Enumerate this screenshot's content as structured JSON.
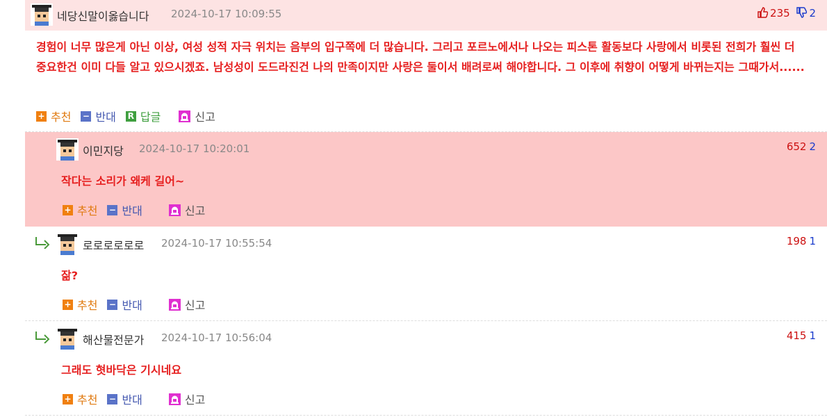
{
  "comments": [
    {
      "nick": "네당신말이옳습니다",
      "date": "2024-10-17 10:09:55",
      "up": "235",
      "down": "2",
      "text": "경험이 너무 많은게 아닌 이상, 여성 성적 자극 위치는 음부의 입구쪽에 더 많습니다. 그리고 포르노에서나 나오는 피스톤 활동보다 사랑에서 비롯된 전희가 훨씬 더 중요한건 이미 다들 알고 있으시겠죠. 남성성이 도드라진건 나의 만족이지만 사랑은 둘이서 배려로써 해야합니다. 그 이후에 취향이 어떻게 바뀌는지는 그때가서......",
      "actions": {
        "up": "추천",
        "down": "반대",
        "reply": "답글",
        "report": "신고"
      }
    },
    {
      "nick": "이민지당",
      "date": "2024-10-17 10:20:01",
      "up": "652",
      "down": "2",
      "text": "작다는 소리가 왜케 길어~",
      "actions": {
        "up": "추천",
        "down": "반대",
        "report": "신고"
      }
    },
    {
      "nick": "로로로로로로",
      "date": "2024-10-17 10:55:54",
      "up": "198",
      "down": "1",
      "text": "잚?",
      "actions": {
        "up": "추천",
        "down": "반대",
        "report": "신고"
      }
    },
    {
      "nick": "해산물전문가",
      "date": "2024-10-17 10:56:04",
      "up": "415",
      "down": "1",
      "text": "그래도 혓바닥은 기시네요",
      "actions": {
        "up": "추천",
        "down": "반대",
        "report": "신고"
      }
    }
  ],
  "icons": {
    "avatar": "graduate-avatar-icon",
    "thumbs_up": "thumbs-up-icon",
    "thumbs_down": "thumbs-down-icon",
    "reply_arrow": "reply-arrow-icon",
    "report": "siren-icon"
  },
  "colors": {
    "highlight_light": "#fde3e3",
    "highlight_strong": "#fcc7c7",
    "comment_text": "#e62020",
    "up_count": "#cc1111",
    "down_count": "#1a3bcc"
  }
}
